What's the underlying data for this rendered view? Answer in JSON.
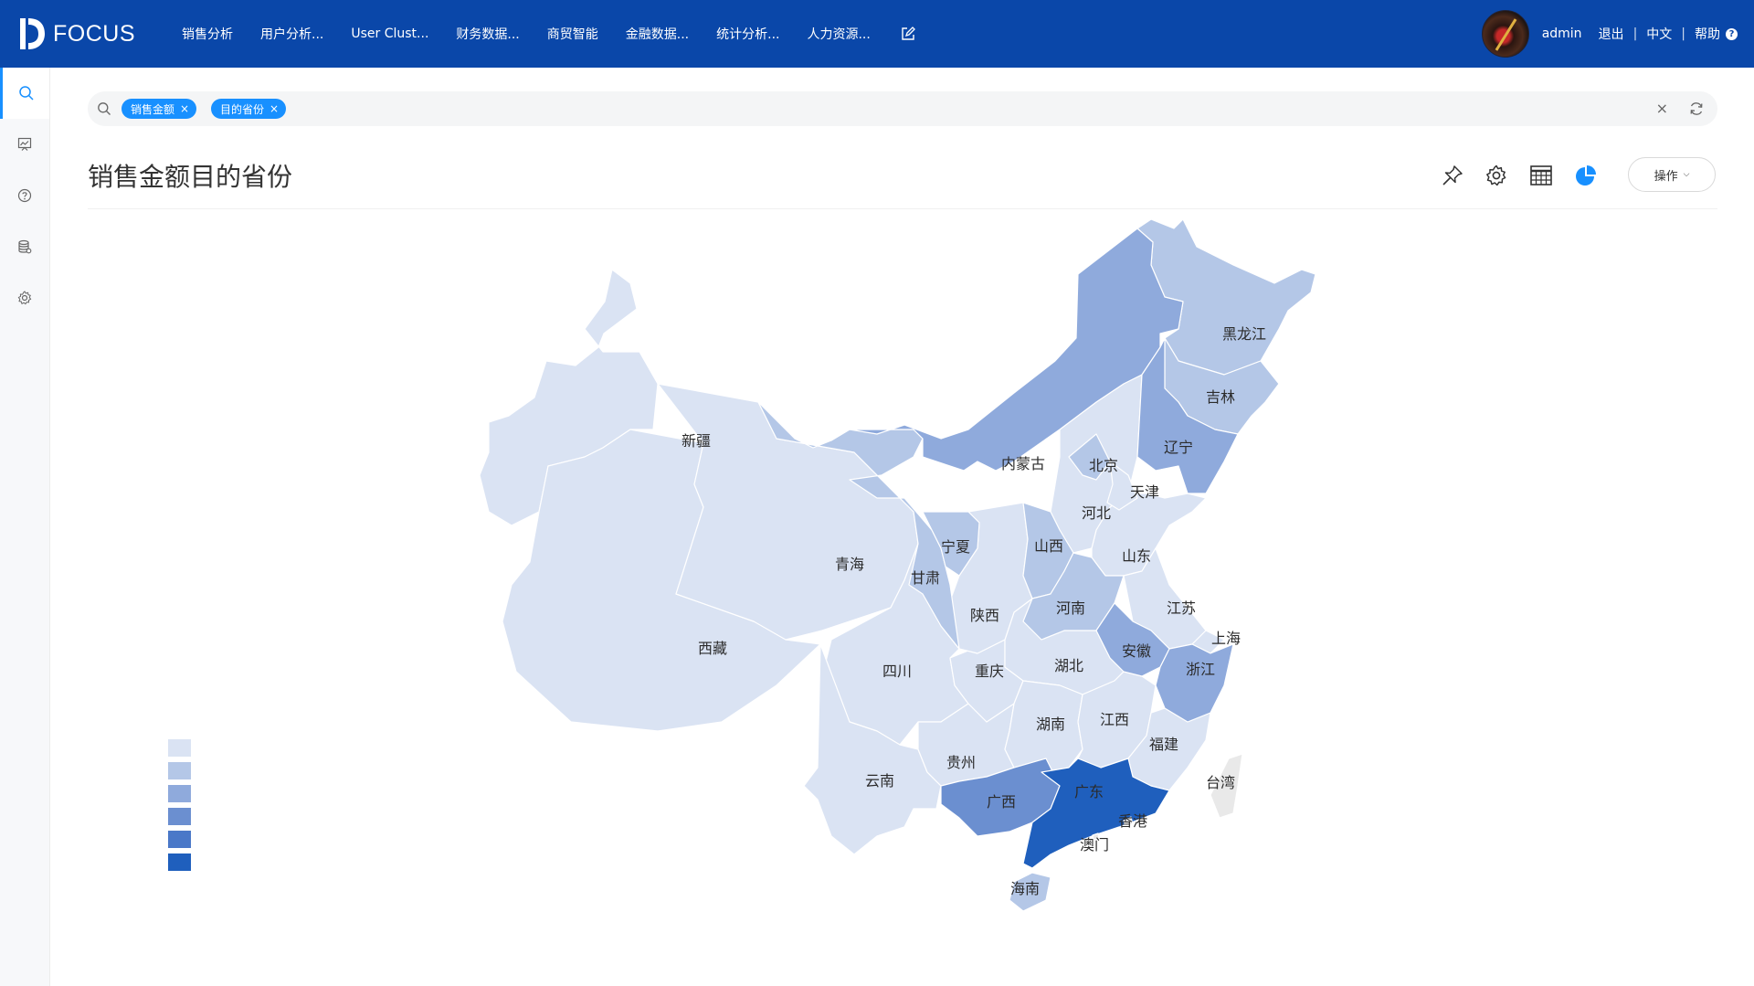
{
  "brand": {
    "name": "FOCUS"
  },
  "nav": {
    "items": [
      "销售分析",
      "用户分析...",
      "User Clust...",
      "财务数据...",
      "商贸智能",
      "金融数据...",
      "统计分析...",
      "人力资源..."
    ]
  },
  "user": {
    "name": "admin",
    "logout": "退出",
    "lang": "中文",
    "help": "帮助",
    "separator": "|"
  },
  "sidebar": {
    "items": [
      {
        "icon": "search-icon"
      },
      {
        "icon": "dashboard-icon"
      },
      {
        "icon": "help-icon"
      },
      {
        "icon": "database-icon"
      },
      {
        "icon": "gear-icon"
      }
    ]
  },
  "search": {
    "tags": [
      {
        "label": "销售金额",
        "close": "×"
      },
      {
        "label": "目的省份",
        "close": "×"
      }
    ],
    "clear": "×"
  },
  "main": {
    "title": "销售金额目的省份",
    "operation_label": "操作",
    "operation_chevron": "⌵"
  },
  "colors": {
    "header": "#0a47a9",
    "accent": "#1890ff",
    "scale": [
      "#dae3f3",
      "#b4c7e7",
      "#8faadc",
      "#6b8fd0",
      "#4a78c8",
      "#1f5fbd"
    ],
    "no_data": "#e9e9e9"
  },
  "chart_data": {
    "type": "choropleth",
    "scale_levels": 6,
    "regions": [
      {
        "name": "新疆",
        "level": 0
      },
      {
        "name": "西藏",
        "level": 0
      },
      {
        "name": "青海",
        "level": 0
      },
      {
        "name": "四川",
        "level": 0
      },
      {
        "name": "云南",
        "level": 0
      },
      {
        "name": "贵州",
        "level": 0
      },
      {
        "name": "重庆",
        "level": 0
      },
      {
        "name": "湖北",
        "level": 0
      },
      {
        "name": "湖南",
        "level": 0
      },
      {
        "name": "江西",
        "level": 0
      },
      {
        "name": "福建",
        "level": 0
      },
      {
        "name": "山东",
        "level": 0
      },
      {
        "name": "河北",
        "level": 0
      },
      {
        "name": "天津",
        "level": 0
      },
      {
        "name": "陕西",
        "level": 0
      },
      {
        "name": "江苏",
        "level": 0
      },
      {
        "name": "上海",
        "level": 0
      },
      {
        "name": "海南",
        "level": 1
      },
      {
        "name": "黑龙江",
        "level": 1
      },
      {
        "name": "吉林",
        "level": 1
      },
      {
        "name": "甘肃",
        "level": 1
      },
      {
        "name": "宁夏",
        "level": 1
      },
      {
        "name": "北京",
        "level": 1
      },
      {
        "name": "山西",
        "level": 1
      },
      {
        "name": "河南",
        "level": 1
      },
      {
        "name": "安徽",
        "level": 2
      },
      {
        "name": "内蒙古",
        "level": 2
      },
      {
        "name": "辽宁",
        "level": 2
      },
      {
        "name": "浙江",
        "level": 2
      },
      {
        "name": "广西",
        "level": 3
      },
      {
        "name": "广东",
        "level": 5
      },
      {
        "name": "香港",
        "level": null
      },
      {
        "name": "澳门",
        "level": null
      },
      {
        "name": "台湾",
        "level": null
      }
    ]
  }
}
